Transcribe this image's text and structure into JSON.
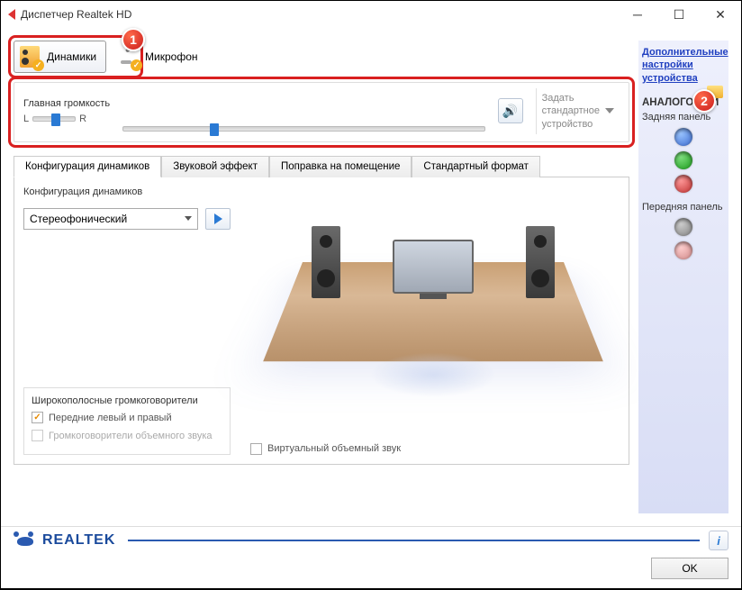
{
  "window": {
    "title": "Диспетчер Realtek HD"
  },
  "badges": {
    "one": "1",
    "two": "2"
  },
  "devtabs": {
    "speakers": "Динамики",
    "microphone": "Микрофон"
  },
  "volume": {
    "label": "Главная громкость",
    "L": "L",
    "R": "R",
    "default_device_line1": "Задать",
    "default_device_line2": "стандартное",
    "default_device_line3": "устройство"
  },
  "cfgtabs": {
    "speakers": "Конфигурация динамиков",
    "effect": "Звуковой эффект",
    "room": "Поправка на помещение",
    "format": "Стандартный формат"
  },
  "config": {
    "group_label": "Конфигурация динамиков",
    "mode": "Стереофонический",
    "wideband_title": "Широкополосные громкоговорители",
    "front_lr": "Передние левый и правый",
    "surround": "Громкоговорители объемного звука",
    "virtual": "Виртуальный объемный звук"
  },
  "side": {
    "advanced": "Дополнительные настройки устройства",
    "analog": "АНАЛОГОВЫЙ",
    "rear": "Задняя панель",
    "front": "Передняя панель"
  },
  "footer": {
    "brand": "REALTEK",
    "ok": "OK"
  }
}
